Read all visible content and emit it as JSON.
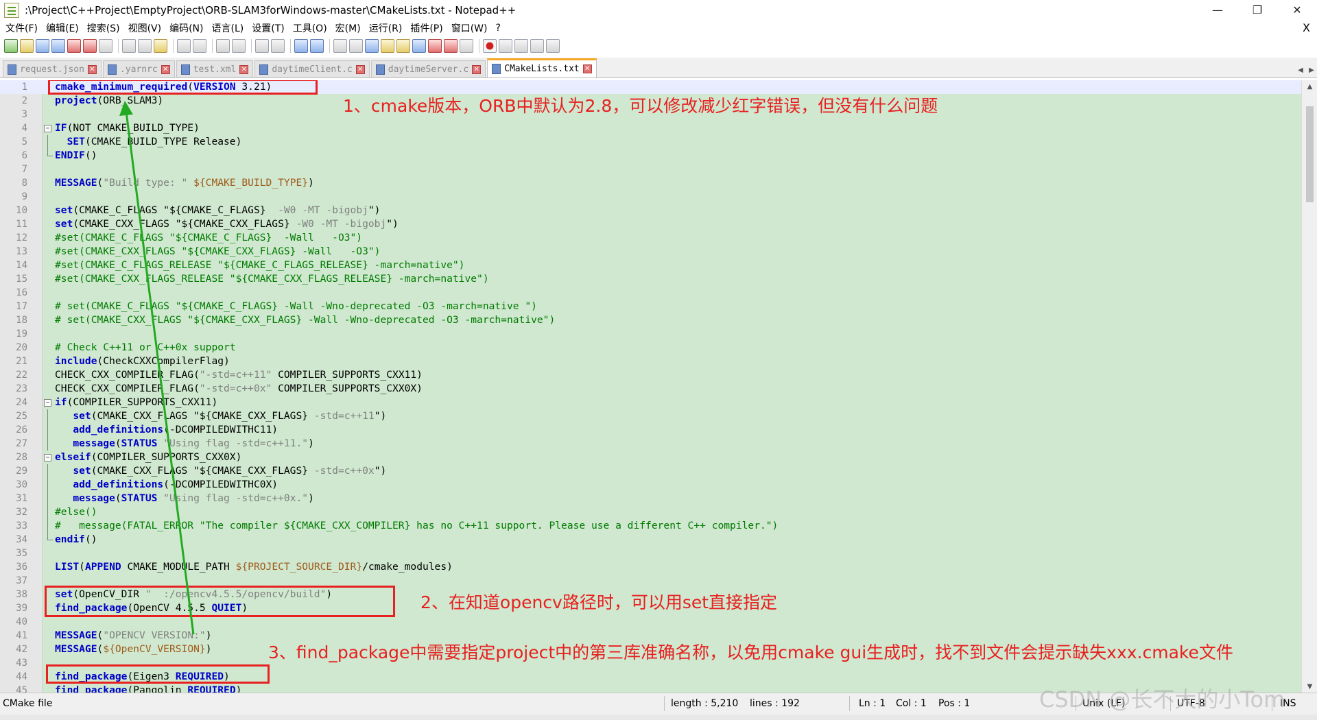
{
  "window": {
    "title": ":\\Project\\C++Project\\EmptyProject\\ORB-SLAM3forWindows-master\\CMakeLists.txt - Notepad++",
    "min": "—",
    "max": "❐",
    "close": "✕"
  },
  "menu": {
    "items": [
      "文件(F)",
      "编辑(E)",
      "搜索(S)",
      "视图(V)",
      "编码(N)",
      "语言(L)",
      "设置(T)",
      "工具(O)",
      "宏(M)",
      "运行(R)",
      "插件(P)",
      "窗口(W)",
      "?"
    ],
    "close": "X"
  },
  "tabs": [
    {
      "label": "request.json",
      "active": false
    },
    {
      "label": ".yarnrc",
      "active": false
    },
    {
      "label": "test.xml",
      "active": false
    },
    {
      "label": "daytimeClient.c",
      "active": false
    },
    {
      "label": "daytimeServer.c",
      "active": false
    },
    {
      "label": "CMakeLists.txt",
      "active": true
    }
  ],
  "editor": {
    "lines": [
      {
        "n": "1",
        "fold": "",
        "seg": [
          [
            "kw",
            "cmake_minimum_required"
          ],
          [
            "pl",
            "("
          ],
          [
            "kw",
            "VERSION"
          ],
          [
            "pl",
            " 3.21)"
          ]
        ]
      },
      {
        "n": "2",
        "fold": "",
        "seg": [
          [
            "kw",
            "project"
          ],
          [
            "pl",
            "(ORB_SLAM3)"
          ]
        ]
      },
      {
        "n": "3",
        "fold": "",
        "seg": []
      },
      {
        "n": "4",
        "fold": "open",
        "seg": [
          [
            "kw",
            "IF"
          ],
          [
            "pl",
            "(NOT CMAKE_BUILD_TYPE)"
          ]
        ]
      },
      {
        "n": "5",
        "fold": "line",
        "seg": [
          [
            "pl",
            "  "
          ],
          [
            "kw",
            "SET"
          ],
          [
            "pl",
            "(CMAKE_BUILD_TYPE Release)"
          ]
        ]
      },
      {
        "n": "6",
        "fold": "end",
        "seg": [
          [
            "kw",
            "ENDIF"
          ],
          [
            "pl",
            "()"
          ]
        ]
      },
      {
        "n": "7",
        "fold": "",
        "seg": []
      },
      {
        "n": "8",
        "fold": "",
        "seg": [
          [
            "kw",
            "MESSAGE"
          ],
          [
            "pl",
            "("
          ],
          [
            "st",
            "\"Build type: \" "
          ],
          [
            "vr",
            "${CMAKE_BUILD_TYPE}"
          ],
          [
            "pl",
            ")"
          ]
        ]
      },
      {
        "n": "9",
        "fold": "",
        "seg": []
      },
      {
        "n": "10",
        "fold": "",
        "seg": [
          [
            "kw",
            "set"
          ],
          [
            "pl",
            "(CMAKE_C_FLAGS \"${CMAKE_C_FLAGS}  "
          ],
          [
            "st",
            "-W0 -MT -bigobj"
          ],
          [
            "pl",
            "\")"
          ]
        ]
      },
      {
        "n": "11",
        "fold": "",
        "seg": [
          [
            "kw",
            "set"
          ],
          [
            "pl",
            "(CMAKE_CXX_FLAGS \"${CMAKE_CXX_FLAGS} "
          ],
          [
            "st",
            "-W0 -MT -bigobj"
          ],
          [
            "pl",
            "\")"
          ]
        ]
      },
      {
        "n": "12",
        "fold": "",
        "seg": [
          [
            "cm",
            "#set(CMAKE_C_FLAGS \"${CMAKE_C_FLAGS}  -Wall   -O3\")"
          ]
        ]
      },
      {
        "n": "13",
        "fold": "",
        "seg": [
          [
            "cm",
            "#set(CMAKE_CXX_FLAGS \"${CMAKE_CXX_FLAGS} -Wall   -O3\")"
          ]
        ]
      },
      {
        "n": "14",
        "fold": "",
        "seg": [
          [
            "cm",
            "#set(CMAKE_C_FLAGS_RELEASE \"${CMAKE_C_FLAGS_RELEASE} -march=native\")"
          ]
        ]
      },
      {
        "n": "15",
        "fold": "",
        "seg": [
          [
            "cm",
            "#set(CMAKE_CXX_FLAGS_RELEASE \"${CMAKE_CXX_FLAGS_RELEASE} -march=native\")"
          ]
        ]
      },
      {
        "n": "16",
        "fold": "",
        "seg": []
      },
      {
        "n": "17",
        "fold": "",
        "seg": [
          [
            "cm",
            "# set(CMAKE_C_FLAGS \"${CMAKE_C_FLAGS} -Wall -Wno-deprecated -O3 -march=native \")"
          ]
        ]
      },
      {
        "n": "18",
        "fold": "",
        "seg": [
          [
            "cm",
            "# set(CMAKE_CXX_FLAGS \"${CMAKE_CXX_FLAGS} -Wall -Wno-deprecated -O3 -march=native\")"
          ]
        ]
      },
      {
        "n": "19",
        "fold": "",
        "seg": []
      },
      {
        "n": "20",
        "fold": "",
        "seg": [
          [
            "cm",
            "# Check C++11 or C++0x support"
          ]
        ]
      },
      {
        "n": "21",
        "fold": "",
        "seg": [
          [
            "kw",
            "include"
          ],
          [
            "pl",
            "(CheckCXXCompilerFlag)"
          ]
        ]
      },
      {
        "n": "22",
        "fold": "",
        "seg": [
          [
            "pl",
            "CHECK_CXX_COMPILER_FLAG("
          ],
          [
            "st",
            "\"-std=c++11\""
          ],
          [
            "pl",
            " COMPILER_SUPPORTS_CXX11)"
          ]
        ]
      },
      {
        "n": "23",
        "fold": "",
        "seg": [
          [
            "pl",
            "CHECK_CXX_COMPILER_FLAG("
          ],
          [
            "st",
            "\"-std=c++0x\""
          ],
          [
            "pl",
            " COMPILER_SUPPORTS_CXX0X)"
          ]
        ]
      },
      {
        "n": "24",
        "fold": "open",
        "seg": [
          [
            "kw",
            "if"
          ],
          [
            "pl",
            "(COMPILER_SUPPORTS_CXX11)"
          ]
        ]
      },
      {
        "n": "25",
        "fold": "line",
        "seg": [
          [
            "pl",
            "   "
          ],
          [
            "kw",
            "set"
          ],
          [
            "pl",
            "(CMAKE_CXX_FLAGS \"${CMAKE_CXX_FLAGS} "
          ],
          [
            "st",
            "-std=c++11"
          ],
          [
            "pl",
            "\")"
          ]
        ]
      },
      {
        "n": "26",
        "fold": "line",
        "seg": [
          [
            "pl",
            "   "
          ],
          [
            "kw",
            "add_definitions"
          ],
          [
            "pl",
            "(-DCOMPILEDWITHC11)"
          ]
        ]
      },
      {
        "n": "27",
        "fold": "line",
        "seg": [
          [
            "pl",
            "   "
          ],
          [
            "kw",
            "message"
          ],
          [
            "pl",
            "("
          ],
          [
            "kw",
            "STATUS"
          ],
          [
            "pl",
            " "
          ],
          [
            "st",
            "\"Using flag -std=c++11.\""
          ],
          [
            "pl",
            ")"
          ]
        ]
      },
      {
        "n": "28",
        "fold": "open",
        "seg": [
          [
            "kw",
            "elseif"
          ],
          [
            "pl",
            "(COMPILER_SUPPORTS_CXX0X)"
          ]
        ]
      },
      {
        "n": "29",
        "fold": "line",
        "seg": [
          [
            "pl",
            "   "
          ],
          [
            "kw",
            "set"
          ],
          [
            "pl",
            "(CMAKE_CXX_FLAGS \"${CMAKE_CXX_FLAGS} "
          ],
          [
            "st",
            "-std=c++0x"
          ],
          [
            "pl",
            "\")"
          ]
        ]
      },
      {
        "n": "30",
        "fold": "line",
        "seg": [
          [
            "pl",
            "   "
          ],
          [
            "kw",
            "add_definitions"
          ],
          [
            "pl",
            "(-DCOMPILEDWITHC0X)"
          ]
        ]
      },
      {
        "n": "31",
        "fold": "line",
        "seg": [
          [
            "pl",
            "   "
          ],
          [
            "kw",
            "message"
          ],
          [
            "pl",
            "("
          ],
          [
            "kw",
            "STATUS"
          ],
          [
            "pl",
            " "
          ],
          [
            "st",
            "\"Using flag -std=c++0x.\""
          ],
          [
            "pl",
            ")"
          ]
        ]
      },
      {
        "n": "32",
        "fold": "line",
        "seg": [
          [
            "cm",
            "#else()"
          ]
        ]
      },
      {
        "n": "33",
        "fold": "line",
        "seg": [
          [
            "cm",
            "#   message(FATAL_ERROR \"The compiler ${CMAKE_CXX_COMPILER} has no C++11 support. Please use a different C++ compiler.\")"
          ]
        ]
      },
      {
        "n": "34",
        "fold": "end",
        "seg": [
          [
            "kw",
            "endif"
          ],
          [
            "pl",
            "()"
          ]
        ]
      },
      {
        "n": "35",
        "fold": "",
        "seg": []
      },
      {
        "n": "36",
        "fold": "",
        "seg": [
          [
            "kw",
            "LIST"
          ],
          [
            "pl",
            "("
          ],
          [
            "kw",
            "APPEND"
          ],
          [
            "pl",
            " CMAKE_MODULE_PATH "
          ],
          [
            "vr",
            "${PROJECT_SOURCE_DIR}"
          ],
          [
            "pl",
            "/cmake_modules)"
          ]
        ]
      },
      {
        "n": "37",
        "fold": "",
        "seg": []
      },
      {
        "n": "38",
        "fold": "",
        "seg": [
          [
            "kw",
            "set"
          ],
          [
            "pl",
            "(OpenCV_DIR "
          ],
          [
            "st",
            "\"  :/opencv4.5.5/opencv/build\""
          ],
          [
            "pl",
            ")"
          ]
        ]
      },
      {
        "n": "39",
        "fold": "",
        "seg": [
          [
            "kw",
            "find_package"
          ],
          [
            "pl",
            "(OpenCV 4.5.5 "
          ],
          [
            "kw",
            "QUIET"
          ],
          [
            "pl",
            ")"
          ]
        ]
      },
      {
        "n": "40",
        "fold": "",
        "seg": []
      },
      {
        "n": "41",
        "fold": "",
        "seg": [
          [
            "kw",
            "MESSAGE"
          ],
          [
            "pl",
            "("
          ],
          [
            "st",
            "\"OPENCV VERSION:\""
          ],
          [
            "pl",
            ")"
          ]
        ]
      },
      {
        "n": "42",
        "fold": "",
        "seg": [
          [
            "kw",
            "MESSAGE"
          ],
          [
            "pl",
            "("
          ],
          [
            "vr",
            "${OpenCV_VERSION}"
          ],
          [
            "pl",
            ")"
          ]
        ]
      },
      {
        "n": "43",
        "fold": "",
        "seg": []
      },
      {
        "n": "44",
        "fold": "",
        "seg": [
          [
            "kw",
            "find_package"
          ],
          [
            "pl",
            "(Eigen3 "
          ],
          [
            "kw",
            "REQUIRED"
          ],
          [
            "pl",
            ")"
          ]
        ]
      },
      {
        "n": "45",
        "fold": "",
        "seg": [
          [
            "kw",
            "find_package"
          ],
          [
            "pl",
            "(Pangolin "
          ],
          [
            "kw",
            "REQUIRED"
          ],
          [
            "pl",
            ")"
          ]
        ]
      }
    ]
  },
  "annotations": {
    "a1": "1、cmake版本，ORB中默认为2.8，可以修改减少红字错误，但没有什么问题",
    "a2": "2、在知道opencv路径时，可以用set直接指定",
    "a3": "3、find_package中需要指定project中的第三库准确名称，以免用cmake gui生成时，找不到文件会提示缺失xxx.cmake文件"
  },
  "status": {
    "filetype": "CMake file",
    "length": "length : 5,210",
    "lines": "lines : 192",
    "ln": "Ln : 1",
    "col": "Col : 1",
    "pos": "Pos : 1",
    "eol": "Unix (LF)",
    "encoding": "UTF-8",
    "mode": "INS"
  },
  "watermark": "CSDN @长不大的小Tom",
  "colors": {
    "keyword": "#0000c8",
    "variable": "#a05a1a",
    "string": "#808080",
    "comment": "#007a00",
    "annotation": "#e82020",
    "arrow": "#22aa22",
    "editor_bg": "#cfe8cf"
  }
}
